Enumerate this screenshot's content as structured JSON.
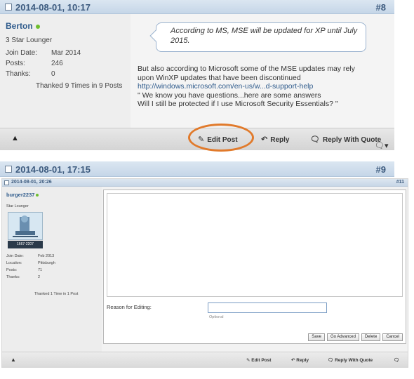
{
  "post1": {
    "date": "2014-08-01, 10:17",
    "number": "#8",
    "user": {
      "name": "Berton",
      "rank": "3 Star Lounger",
      "stats": [
        {
          "label": "Join Date:",
          "value": "Mar 2014"
        },
        {
          "label": "Posts:",
          "value": "246"
        },
        {
          "label": "Thanks:",
          "value": "0"
        }
      ],
      "thanked": "Thanked 9 Times in 9 Posts"
    },
    "quote": "According to MS, MSE will be updated for XP until July 2015.",
    "body_lines": [
      "But also according to Microsoft some of the MSE updates may rely",
      "upon WinXP updates that have been discontinued"
    ],
    "link": "http://windows.microsoft.com/en-us/w...d-support-help",
    "body_lines2": [
      "\" We know you have questions...here are some answers",
      "Will I still be protected if I use Microsoft Security Essentials? \""
    ],
    "footer": {
      "edit_post": "Edit Post",
      "reply": "Reply",
      "reply_with_quote": "Reply With Quote"
    }
  },
  "post2": {
    "date": "2014-08-01, 17:15",
    "number": "#9"
  },
  "inner": {
    "date": "2014-08-01, 20:26",
    "number": "#11",
    "user": {
      "name": "burger2237",
      "rank": "Star Lounger",
      "badge": "1667-2207",
      "stats": [
        {
          "label": "Join Date:",
          "value": "Feb 2013"
        },
        {
          "label": "Location:",
          "value": "Pittsburgh"
        },
        {
          "label": "Posts:",
          "value": "71"
        },
        {
          "label": "Thanks:",
          "value": "2"
        }
      ],
      "thanked": "Thanked 1 Time in 1 Post"
    },
    "editor": {
      "reason_label": "Reason for Editing:",
      "reason_hint": "Optional",
      "buttons": {
        "save": "Save",
        "go_advanced": "Go Advanced",
        "delete": "Delete",
        "cancel": "Cancel"
      }
    },
    "footer": {
      "edit_post": "Edit Post",
      "reply": "Reply",
      "reply_with_quote": "Reply With Quote"
    }
  },
  "colors": {
    "highlight_circle": "#e17a2b",
    "header_text": "#3c5a7e",
    "online_dot": "#6fbf2e"
  }
}
